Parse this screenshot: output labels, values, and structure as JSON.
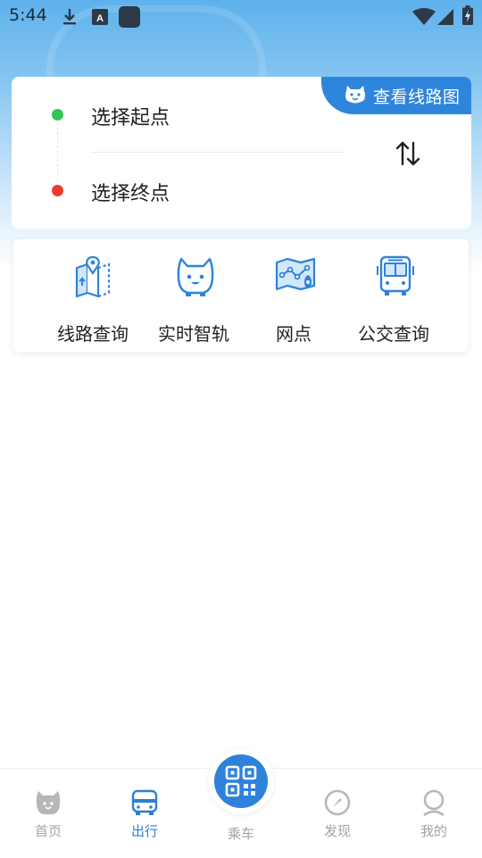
{
  "status_bar": {
    "time": "5:44",
    "icons": [
      "download-icon",
      "app-a-icon",
      "app-square-icon",
      "wifi-icon",
      "signal-icon",
      "battery-icon"
    ]
  },
  "route": {
    "view_map_label": "查看线路图",
    "start_placeholder": "选择起点",
    "end_placeholder": "选择终点",
    "start_dot_color": "#33c653",
    "end_dot_color": "#ea3d2f"
  },
  "services": [
    {
      "label": "线路查询",
      "icon": "route-map-icon"
    },
    {
      "label": "实时智轨",
      "icon": "mascot-icon"
    },
    {
      "label": "网点",
      "icon": "map-pin-icon"
    },
    {
      "label": "公交查询",
      "icon": "bus-icon"
    }
  ],
  "nav": {
    "items": [
      {
        "label": "首页",
        "icon": "home-mascot-icon"
      },
      {
        "label": "出行",
        "icon": "car-icon"
      },
      {
        "label": "乘车",
        "icon": "qr-code-icon"
      },
      {
        "label": "发现",
        "icon": "compass-icon"
      },
      {
        "label": "我的",
        "icon": "user-icon"
      }
    ],
    "active_color": "#2c7fd6",
    "inactive_color": "#a3a3a3"
  },
  "colors": {
    "accent": "#2e86dc",
    "hero_top": "#5eb1ec"
  }
}
